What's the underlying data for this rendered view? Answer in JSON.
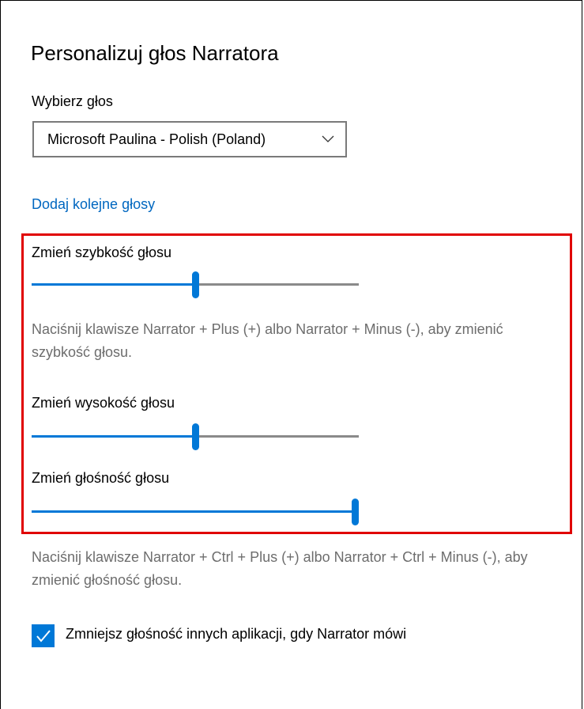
{
  "page": {
    "title": "Personalizuj głos Narratora"
  },
  "voice": {
    "label": "Wybierz głos",
    "selected": "Microsoft Paulina - Polish (Poland)",
    "more_link": "Dodaj kolejne głosy"
  },
  "speed": {
    "label": "Zmień szybkość głosu",
    "value_fraction": 0.5,
    "hint": "Naciśnij klawisze Narrator + Plus (+) albo Narrator + Minus (-), aby zmienić szybkość głosu."
  },
  "pitch": {
    "label": "Zmień wysokość głosu",
    "value_fraction": 0.5
  },
  "volume": {
    "label": "Zmień głośność głosu",
    "value_fraction": 1.0,
    "hint": "Naciśnij klawisze Narrator + Ctrl + Plus (+) albo Narrator + Ctrl + Minus (-), aby zmienić głośność głosu."
  },
  "lower_others": {
    "label": "Zmniejsz głośność innych aplikacji, gdy Narrator mówi",
    "checked": true
  },
  "colors": {
    "accent": "#0078d7",
    "link": "#0067c0",
    "highlight": "#e00000",
    "muted_text": "#6d6d6d"
  }
}
